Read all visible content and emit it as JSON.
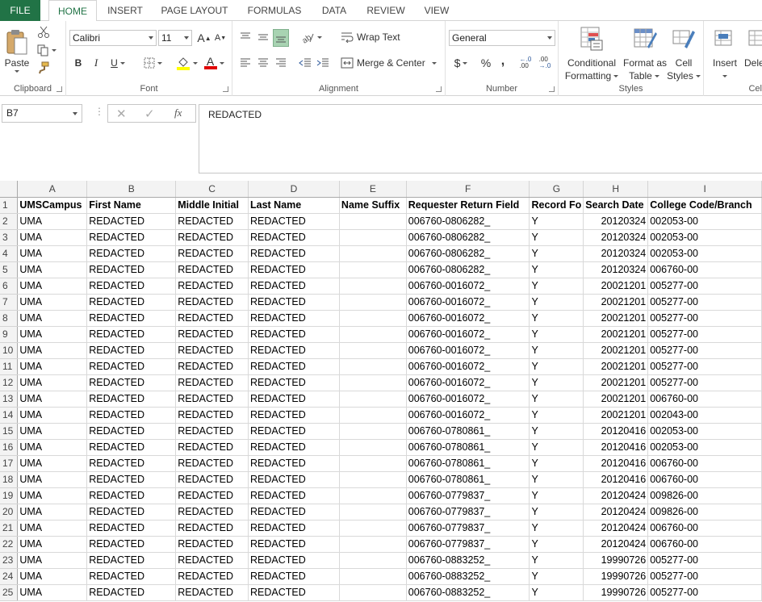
{
  "tabs": [
    "FILE",
    "HOME",
    "INSERT",
    "PAGE LAYOUT",
    "FORMULAS",
    "DATA",
    "REVIEW",
    "VIEW"
  ],
  "active_tab": "HOME",
  "ribbon": {
    "clipboard": {
      "label": "Clipboard",
      "paste": "Paste"
    },
    "font": {
      "label": "Font",
      "font_name": "Calibri",
      "font_size": "11",
      "bold": "B",
      "italic": "I",
      "underline": "U",
      "grow": "A",
      "shrink": "A",
      "color_letter": "A"
    },
    "alignment": {
      "label": "Alignment",
      "wrap_text": "Wrap Text",
      "merge_center": "Merge & Center"
    },
    "number": {
      "label": "Number",
      "format": "General",
      "currency": "$",
      "percent": "%",
      "comma": ",",
      "inc_decimal": "←.0 .00",
      "dec_decimal": ".00 →.0"
    },
    "styles": {
      "label": "Styles",
      "conditional_1": "Conditional",
      "conditional_2": "Formatting",
      "format_table_1": "Format as",
      "format_table_2": "Table",
      "cell_styles_1": "Cell",
      "cell_styles_2": "Styles"
    },
    "cells": {
      "label": "Cel",
      "insert": "Insert",
      "delete": "Dele"
    }
  },
  "formula_bar": {
    "name_box": "B7",
    "fx": "fx",
    "value": "REDACTED"
  },
  "accent": "#217346",
  "columns": [
    "A",
    "B",
    "C",
    "D",
    "E",
    "F",
    "G",
    "H",
    "I"
  ],
  "rows": [
    [
      "1",
      "UMSCampus",
      "First Name",
      "Middle Initial",
      "Last Name",
      "Name Suffix",
      "Requester Return Field",
      "Record Fo",
      "Search Date",
      "College Code/Branch"
    ],
    [
      "2",
      "UMA",
      "REDACTED",
      "REDACTED",
      "REDACTED",
      "",
      "006760-0806282_",
      "Y",
      "20120324",
      "002053-00"
    ],
    [
      "3",
      "UMA",
      "REDACTED",
      "REDACTED",
      "REDACTED",
      "",
      "006760-0806282_",
      "Y",
      "20120324",
      "002053-00"
    ],
    [
      "4",
      "UMA",
      "REDACTED",
      "REDACTED",
      "REDACTED",
      "",
      "006760-0806282_",
      "Y",
      "20120324",
      "002053-00"
    ],
    [
      "5",
      "UMA",
      "REDACTED",
      "REDACTED",
      "REDACTED",
      "",
      "006760-0806282_",
      "Y",
      "20120324",
      "006760-00"
    ],
    [
      "6",
      "UMA",
      "REDACTED",
      "REDACTED",
      "REDACTED",
      "",
      "006760-0016072_",
      "Y",
      "20021201",
      "005277-00"
    ],
    [
      "7",
      "UMA",
      "REDACTED",
      "REDACTED",
      "REDACTED",
      "",
      "006760-0016072_",
      "Y",
      "20021201",
      "005277-00"
    ],
    [
      "8",
      "UMA",
      "REDACTED",
      "REDACTED",
      "REDACTED",
      "",
      "006760-0016072_",
      "Y",
      "20021201",
      "005277-00"
    ],
    [
      "9",
      "UMA",
      "REDACTED",
      "REDACTED",
      "REDACTED",
      "",
      "006760-0016072_",
      "Y",
      "20021201",
      "005277-00"
    ],
    [
      "10",
      "UMA",
      "REDACTED",
      "REDACTED",
      "REDACTED",
      "",
      "006760-0016072_",
      "Y",
      "20021201",
      "005277-00"
    ],
    [
      "11",
      "UMA",
      "REDACTED",
      "REDACTED",
      "REDACTED",
      "",
      "006760-0016072_",
      "Y",
      "20021201",
      "005277-00"
    ],
    [
      "12",
      "UMA",
      "REDACTED",
      "REDACTED",
      "REDACTED",
      "",
      "006760-0016072_",
      "Y",
      "20021201",
      "005277-00"
    ],
    [
      "13",
      "UMA",
      "REDACTED",
      "REDACTED",
      "REDACTED",
      "",
      "006760-0016072_",
      "Y",
      "20021201",
      "006760-00"
    ],
    [
      "14",
      "UMA",
      "REDACTED",
      "REDACTED",
      "REDACTED",
      "",
      "006760-0016072_",
      "Y",
      "20021201",
      "002043-00"
    ],
    [
      "15",
      "UMA",
      "REDACTED",
      "REDACTED",
      "REDACTED",
      "",
      "006760-0780861_",
      "Y",
      "20120416",
      "002053-00"
    ],
    [
      "16",
      "UMA",
      "REDACTED",
      "REDACTED",
      "REDACTED",
      "",
      "006760-0780861_",
      "Y",
      "20120416",
      "002053-00"
    ],
    [
      "17",
      "UMA",
      "REDACTED",
      "REDACTED",
      "REDACTED",
      "",
      "006760-0780861_",
      "Y",
      "20120416",
      "006760-00"
    ],
    [
      "18",
      "UMA",
      "REDACTED",
      "REDACTED",
      "REDACTED",
      "",
      "006760-0780861_",
      "Y",
      "20120416",
      "006760-00"
    ],
    [
      "19",
      "UMA",
      "REDACTED",
      "REDACTED",
      "REDACTED",
      "",
      "006760-0779837_",
      "Y",
      "20120424",
      "009826-00"
    ],
    [
      "20",
      "UMA",
      "REDACTED",
      "REDACTED",
      "REDACTED",
      "",
      "006760-0779837_",
      "Y",
      "20120424",
      "009826-00"
    ],
    [
      "21",
      "UMA",
      "REDACTED",
      "REDACTED",
      "REDACTED",
      "",
      "006760-0779837_",
      "Y",
      "20120424",
      "006760-00"
    ],
    [
      "22",
      "UMA",
      "REDACTED",
      "REDACTED",
      "REDACTED",
      "",
      "006760-0779837_",
      "Y",
      "20120424",
      "006760-00"
    ],
    [
      "23",
      "UMA",
      "REDACTED",
      "REDACTED",
      "REDACTED",
      "",
      "006760-0883252_",
      "Y",
      "19990726",
      "005277-00"
    ],
    [
      "24",
      "UMA",
      "REDACTED",
      "REDACTED",
      "REDACTED",
      "",
      "006760-0883252_",
      "Y",
      "19990726",
      "005277-00"
    ],
    [
      "25",
      "UMA",
      "REDACTED",
      "REDACTED",
      "REDACTED",
      "",
      "006760-0883252_",
      "Y",
      "19990726",
      "005277-00"
    ]
  ]
}
